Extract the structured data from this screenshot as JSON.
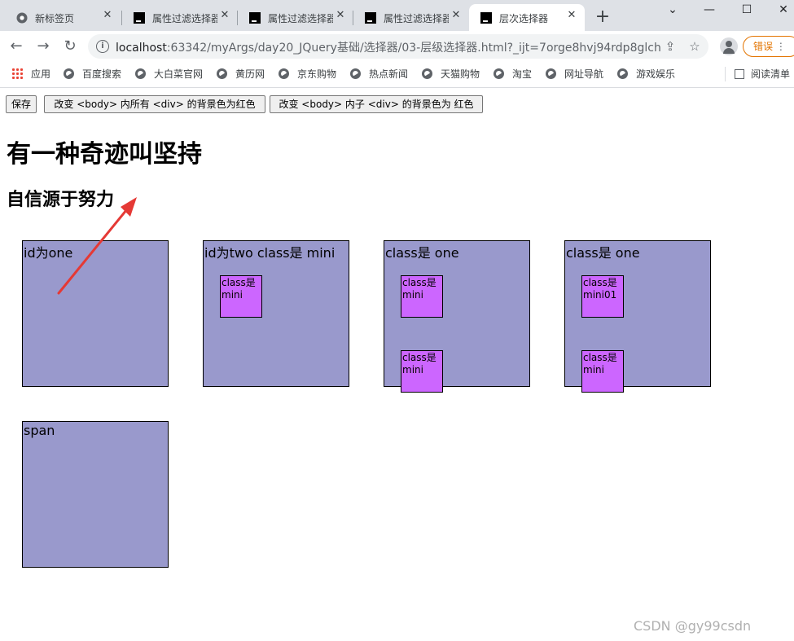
{
  "browser": {
    "tabs": [
      {
        "label": "新标签页",
        "icon": "chrome-icon"
      },
      {
        "label": "属性过滤选择器",
        "icon": "intellij-icon"
      },
      {
        "label": "属性过滤选择器",
        "icon": "intellij-icon"
      },
      {
        "label": "属性过滤选择器",
        "icon": "intellij-icon"
      },
      {
        "label": "层次选择器",
        "icon": "intellij-icon"
      }
    ],
    "url_host": "localhost",
    "url_rest": ":63342/myArgs/day20_JQuery基础/选择器/03-层级选择器.html?_ijt=7orge8hvj94rdp8glch...",
    "error_label": "错误",
    "bookmarks": [
      "应用",
      "百度搜索",
      "大白菜官网",
      "黄历网",
      "京东购物",
      "热点新闻",
      "天猫购物",
      "淘宝",
      "网址导航",
      "游戏娱乐"
    ],
    "reading_list": "阅读清单"
  },
  "page": {
    "buttons": {
      "save": "保存",
      "all_div": "改变 <body> 内所有 <div> 的背景色为红色",
      "child_div": "改变 <body> 内子 <div> 的背景色为 红色"
    },
    "h1": "有一种奇迹叫坚持",
    "h2": "自信源于努力",
    "boxes": [
      {
        "label": "id为one"
      },
      {
        "label": "id为two class是 mini",
        "mini": [
          "class是mini"
        ]
      },
      {
        "label": "class是 one",
        "mini": [
          "class是mini",
          "class是mini"
        ]
      },
      {
        "label": "class是 one",
        "mini": [
          "class是mini01",
          "class是mini"
        ]
      },
      {
        "label": "span"
      }
    ]
  },
  "watermark": "CSDN @gy99csdn",
  "colors": {
    "box": "#9999cc",
    "mini": "#cc66ff",
    "arrow": "#e53935",
    "error": "#e37400"
  }
}
